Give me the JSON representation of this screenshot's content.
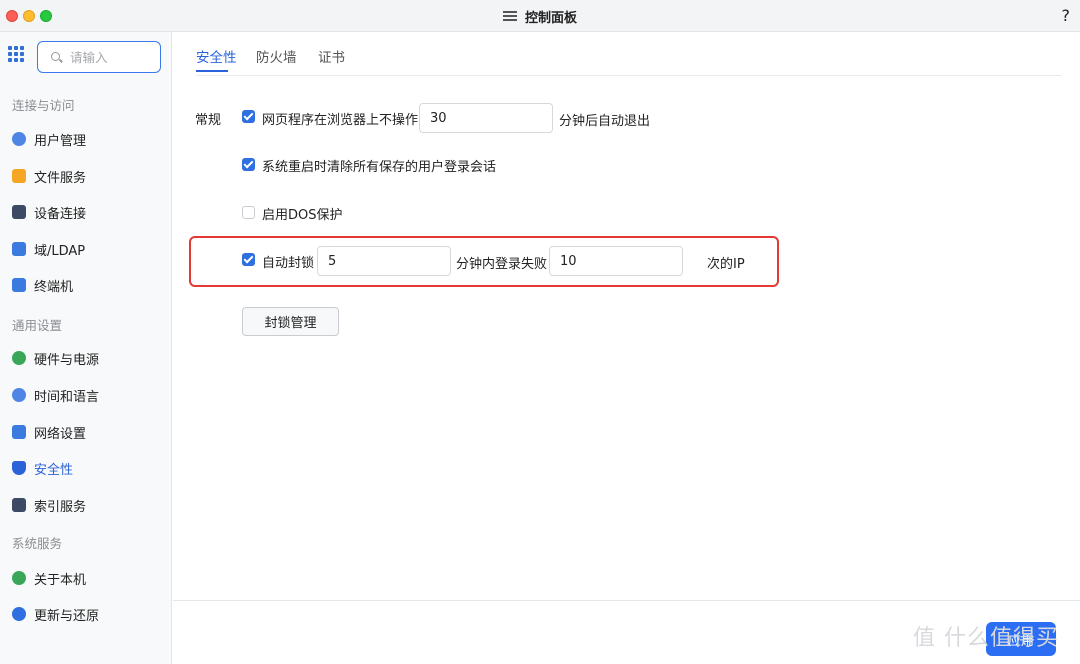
{
  "window": {
    "title": "控制面板",
    "help": "?"
  },
  "sidebar": {
    "search_placeholder": "请输入",
    "sections": [
      {
        "label": "连接与访问"
      },
      {
        "label": "通用设置"
      },
      {
        "label": "系统服务"
      }
    ],
    "items": [
      {
        "label": "用户管理",
        "icon": "user-icon"
      },
      {
        "label": "文件服务",
        "icon": "folder-icon"
      },
      {
        "label": "设备连接",
        "icon": "device-icon"
      },
      {
        "label": "域/LDAP",
        "icon": "domain-icon"
      },
      {
        "label": "终端机",
        "icon": "terminal-icon"
      },
      {
        "label": "硬件与电源",
        "icon": "power-icon"
      },
      {
        "label": "时间和语言",
        "icon": "globe-icon"
      },
      {
        "label": "网络设置",
        "icon": "network-icon"
      },
      {
        "label": "安全性",
        "icon": "shield-icon",
        "active": true
      },
      {
        "label": "索引服务",
        "icon": "index-icon"
      },
      {
        "label": "关于本机",
        "icon": "info-icon"
      },
      {
        "label": "更新与还原",
        "icon": "update-icon"
      }
    ]
  },
  "tabs": [
    {
      "label": "安全性",
      "active": true
    },
    {
      "label": "防火墙"
    },
    {
      "label": "证书"
    }
  ],
  "general": {
    "section_label": "常规",
    "auto_logout": {
      "label": "网页程序在浏览器上不操作",
      "value": "30",
      "suffix": "分钟后自动退出",
      "checked": true
    },
    "clear_sessions": {
      "label": "系统重启时清除所有保存的用户登录会话",
      "checked": true
    },
    "dos": {
      "label": "启用DOS保护",
      "checked": false
    },
    "auto_block": {
      "label": "自动封锁",
      "minutes": "5",
      "mid_label": "分钟内登录失败",
      "attempts": "10",
      "suffix": "次的IP",
      "checked": true
    },
    "block_manage_button": "封锁管理"
  },
  "footer": {
    "apply_label": "应用"
  },
  "watermark": "值 什么值得买",
  "colors": {
    "accent": "#2a63d9",
    "highlight_box": "#e53935",
    "apply_button": "#2b6ef3"
  }
}
